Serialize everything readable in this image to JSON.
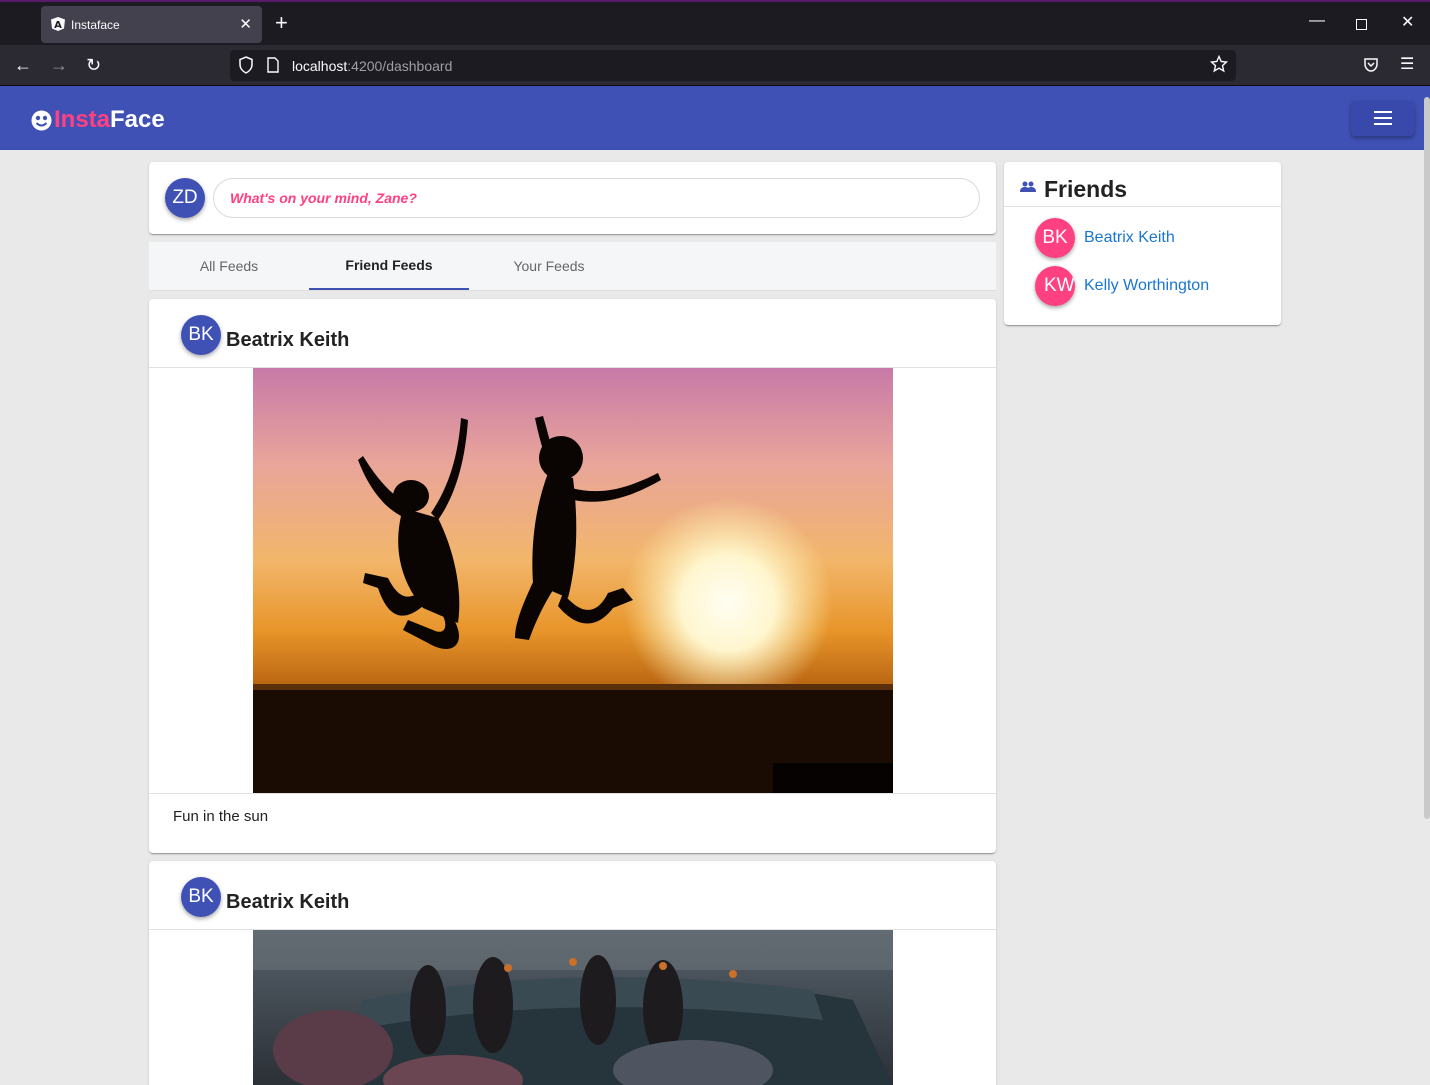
{
  "browser": {
    "tab_title": "Instaface",
    "url_host": "localhost",
    "url_path": ":4200/dashboard"
  },
  "app": {
    "logo_part1": "Insta",
    "logo_part2": "Face",
    "brand_color": "#3f51b5",
    "accent_color": "#ff4081"
  },
  "composer": {
    "user_initials": "ZD",
    "placeholder": "What's on your mind, Zane?"
  },
  "tabs": [
    {
      "label": "All Feeds",
      "active": false
    },
    {
      "label": "Friend Feeds",
      "active": true
    },
    {
      "label": "Your Feeds",
      "active": false
    }
  ],
  "feeds": [
    {
      "initials": "BK",
      "author": "Beatrix Keith",
      "caption": "Fun in the sun",
      "image": "silhouette-jump-sunset"
    },
    {
      "initials": "BK",
      "author": "Beatrix Keith",
      "caption": "",
      "image": "friends-on-car"
    }
  ],
  "friends": {
    "title": "Friends",
    "items": [
      {
        "initials": "BK",
        "name": "Beatrix Keith"
      },
      {
        "initials": "KW",
        "name": "Kelly Worthington"
      }
    ]
  }
}
